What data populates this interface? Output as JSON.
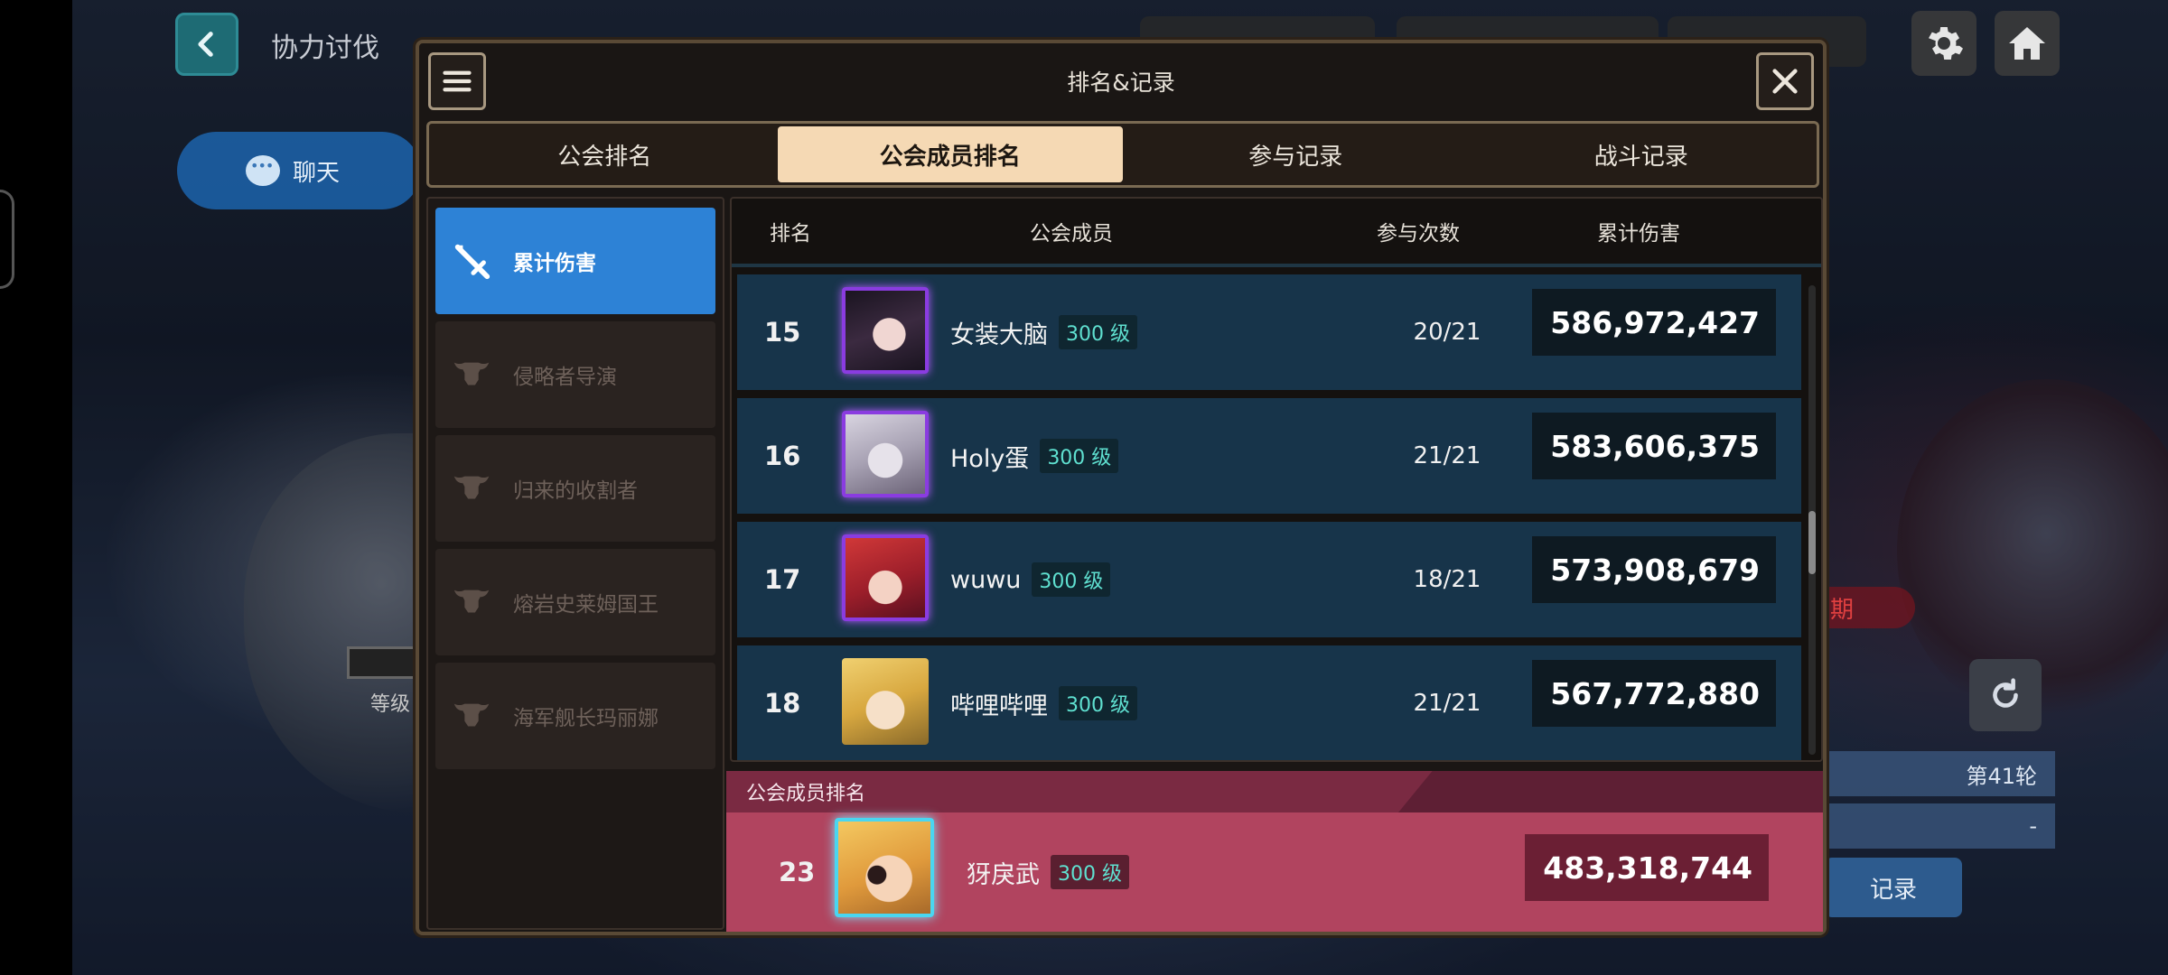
{
  "background": {
    "title": "协力讨伐",
    "chat_label": "聊天",
    "level_label": "等级",
    "period_text": "期",
    "round_text": "第41轮",
    "dash_text": "-",
    "record_text": "记录"
  },
  "modal": {
    "title": "排名&记录",
    "tabs": [
      "公会排名",
      "公会成员排名",
      "参与记录",
      "战斗记录"
    ],
    "active_tab": 1,
    "categories": [
      {
        "label": "累计伤害",
        "icon": "sword-icon",
        "active": true
      },
      {
        "label": "侵略者导演",
        "icon": "bull-skull-icon",
        "active": false
      },
      {
        "label": "归来的收割者",
        "icon": "bull-skull-icon",
        "active": false
      },
      {
        "label": "熔岩史莱姆国王",
        "icon": "bull-skull-icon",
        "active": false
      },
      {
        "label": "海军舰长玛丽娜",
        "icon": "bull-skull-icon",
        "active": false
      }
    ],
    "columns": {
      "rank": "排名",
      "member": "公会成员",
      "participation": "参与次数",
      "damage": "累计伤害"
    },
    "rows": [
      {
        "rank": "15",
        "name": "女装大脑",
        "level": "300 级",
        "times": "20/21",
        "damage": "586,972,427",
        "avatar": "purple"
      },
      {
        "rank": "16",
        "name": "Holy蛋",
        "level": "300 级",
        "times": "21/21",
        "damage": "583,606,375",
        "avatar": "purple"
      },
      {
        "rank": "17",
        "name": "wuwu",
        "level": "300 级",
        "times": "18/21",
        "damage": "573,908,679",
        "avatar": "purple"
      },
      {
        "rank": "18",
        "name": "哔哩哔哩",
        "level": "300 级",
        "times": "21/21",
        "damage": "567,772,880",
        "avatar": "plain"
      }
    ],
    "self": {
      "header": "公会成员排名",
      "rank": "23",
      "name": "犽戾武",
      "level": "300 级",
      "damage": "483,318,744"
    }
  },
  "colors": {
    "active_category": "#2d82d6",
    "active_tab": "#f5d9b4",
    "row_bg": "#17344a",
    "self_row_bg": "#b1445f",
    "level_text": "#5fe0d0"
  }
}
